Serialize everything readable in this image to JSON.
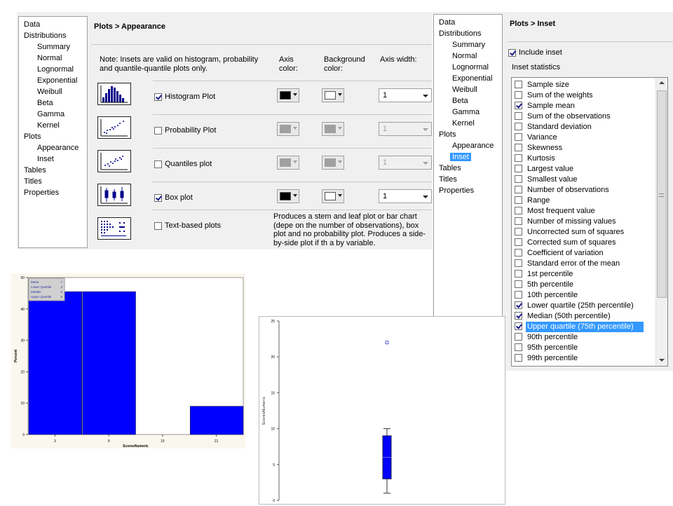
{
  "nav": {
    "items": [
      {
        "label": "Data",
        "level": 0
      },
      {
        "label": "Distributions",
        "level": 0
      },
      {
        "label": "Summary",
        "level": 1
      },
      {
        "label": "Normal",
        "level": 1
      },
      {
        "label": "Lognormal",
        "level": 1
      },
      {
        "label": "Exponential",
        "level": 1
      },
      {
        "label": "Weibull",
        "level": 1
      },
      {
        "label": "Beta",
        "level": 1
      },
      {
        "label": "Gamma",
        "level": 1
      },
      {
        "label": "Kernel",
        "level": 1
      },
      {
        "label": "Plots",
        "level": 0
      },
      {
        "label": "Appearance",
        "level": 1
      },
      {
        "label": "Inset",
        "level": 1
      },
      {
        "label": "Tables",
        "level": 0
      },
      {
        "label": "Titles",
        "level": 0
      },
      {
        "label": "Properties",
        "level": 0
      }
    ]
  },
  "appearance": {
    "title": "Plots > Appearance",
    "note": "Note: Insets are valid on histogram, probability and quantile-quantile plots only.",
    "col_axis_color": "Axis color:",
    "col_background_color": "Background color:",
    "col_axis_width": "Axis width:",
    "plots": [
      {
        "label": "Histogram Plot",
        "checked": true,
        "icon": "histogram-icon",
        "axis_color": "#000000",
        "bg_color": "#ffffff",
        "width": "1",
        "enabled": true
      },
      {
        "label": "Probability Plot",
        "checked": false,
        "icon": "probability-plot-icon",
        "axis_color": "#a0a0a0",
        "bg_color": "#a0a0a0",
        "width": "1",
        "enabled": false
      },
      {
        "label": "Quantiles plot",
        "checked": false,
        "icon": "quantile-plot-icon",
        "axis_color": "#a0a0a0",
        "bg_color": "#a0a0a0",
        "width": "1",
        "enabled": false
      },
      {
        "label": "Box plot",
        "checked": true,
        "icon": "box-plot-icon",
        "axis_color": "#000000",
        "bg_color": "#ffffff",
        "width": "1",
        "enabled": true
      },
      {
        "label": "Text-based plots",
        "checked": false,
        "icon": "text-plot-icon"
      }
    ],
    "text_plot_desc": "Produces a stem and leaf plot or bar chart (depe on the number of observations), box plot and no probability plot. Produces a side-by-side plot if th a by variable."
  },
  "inset": {
    "title": "Plots > Inset",
    "include_label": "Include inset",
    "include_checked": true,
    "stats_label": "Inset statistics",
    "stats": [
      {
        "label": "Sample size",
        "checked": false
      },
      {
        "label": "Sum of the weights",
        "checked": false
      },
      {
        "label": "Sample mean",
        "checked": true
      },
      {
        "label": "Sum of the observations",
        "checked": false
      },
      {
        "label": "Standard deviation",
        "checked": false
      },
      {
        "label": "Variance",
        "checked": false
      },
      {
        "label": "Skewness",
        "checked": false
      },
      {
        "label": "Kurtosis",
        "checked": false
      },
      {
        "label": "Largest value",
        "checked": false
      },
      {
        "label": "Smallest value",
        "checked": false
      },
      {
        "label": "Number of observations",
        "checked": false
      },
      {
        "label": "Range",
        "checked": false
      },
      {
        "label": "Most frequent value",
        "checked": false
      },
      {
        "label": "Number of missing values",
        "checked": false
      },
      {
        "label": "Uncorrected sum of squares",
        "checked": false
      },
      {
        "label": "Corrected sum of squares",
        "checked": false
      },
      {
        "label": "Coefficient of variation",
        "checked": false
      },
      {
        "label": "Standard error of the mean",
        "checked": false
      },
      {
        "label": "1st percentile",
        "checked": false
      },
      {
        "label": "5th percentile",
        "checked": false
      },
      {
        "label": "10th percentile",
        "checked": false
      },
      {
        "label": "Lower quartile (25th percentile)",
        "checked": true
      },
      {
        "label": "Median (50th percentile)",
        "checked": true
      },
      {
        "label": "Upper quartile (75th percentile)",
        "checked": true,
        "selected": true
      },
      {
        "label": "90th percentile",
        "checked": false
      },
      {
        "label": "95th percentile",
        "checked": false
      },
      {
        "label": "99th percentile",
        "checked": false
      }
    ]
  },
  "chart_data": [
    {
      "type": "bar",
      "categories": [
        "3",
        "9",
        "15",
        "21"
      ],
      "values": [
        45.5,
        45.5,
        0,
        9
      ],
      "xlabel": "ScoresNumeric",
      "ylabel": "Percent",
      "ylim": [
        0,
        50
      ],
      "yticks": [
        "0",
        "10",
        "20",
        "30",
        "40",
        "50"
      ],
      "bar_color": "#0000ff",
      "inset": [
        {
          "label": "Mean",
          "value": "7"
        },
        {
          "label": "Lower Quartile",
          "value": "3"
        },
        {
          "label": "Median",
          "value": "6"
        },
        {
          "label": "Upper Quartile",
          "value": "9"
        }
      ]
    },
    {
      "type": "box",
      "ylabel": "ScoresNumeric",
      "ylim": [
        0,
        25
      ],
      "yticks": [
        "0",
        "5",
        "10",
        "15",
        "20",
        "25"
      ],
      "whisker_low": 1,
      "q1": 3,
      "median": 6,
      "q3": 9,
      "whisker_high": 10,
      "outliers": [
        22
      ],
      "box_color": "#0000ff"
    }
  ]
}
